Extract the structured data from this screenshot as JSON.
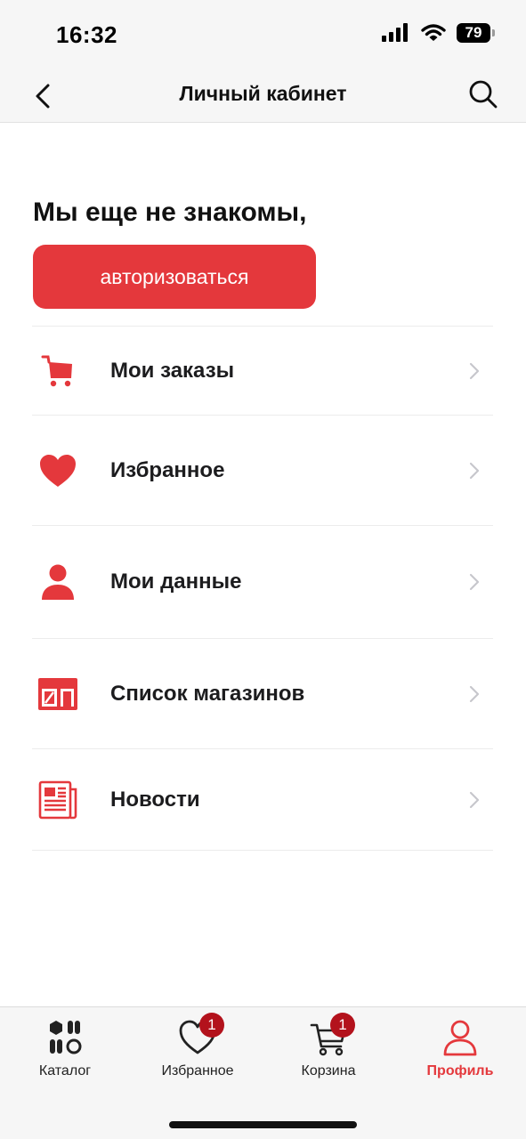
{
  "status_bar": {
    "time": "16:32",
    "battery": "79"
  },
  "header": {
    "title": "Личный кабинет"
  },
  "greeting": "Мы еще не знакомы,",
  "auth_button": "авторизоваться",
  "menu": {
    "items": [
      {
        "label": "Мои заказы",
        "icon": "cart-icon"
      },
      {
        "label": "Избранное",
        "icon": "heart-icon"
      },
      {
        "label": "Мои данные",
        "icon": "user-icon"
      },
      {
        "label": "Список магазинов",
        "icon": "store-icon"
      },
      {
        "label": "Новости",
        "icon": "newspaper-icon"
      }
    ]
  },
  "tab_bar": {
    "tabs": [
      {
        "label": "Каталог",
        "icon": "catalog-icon",
        "active": false
      },
      {
        "label": "Избранное",
        "icon": "heart-outline-icon",
        "badge": "1",
        "active": false
      },
      {
        "label": "Корзина",
        "icon": "cart-outline-icon",
        "badge": "1",
        "active": false
      },
      {
        "label": "Профиль",
        "icon": "profile-icon",
        "active": true
      }
    ]
  },
  "colors": {
    "accent": "#e4383c",
    "badge": "#b3121c",
    "text": "#1c1c1e"
  }
}
